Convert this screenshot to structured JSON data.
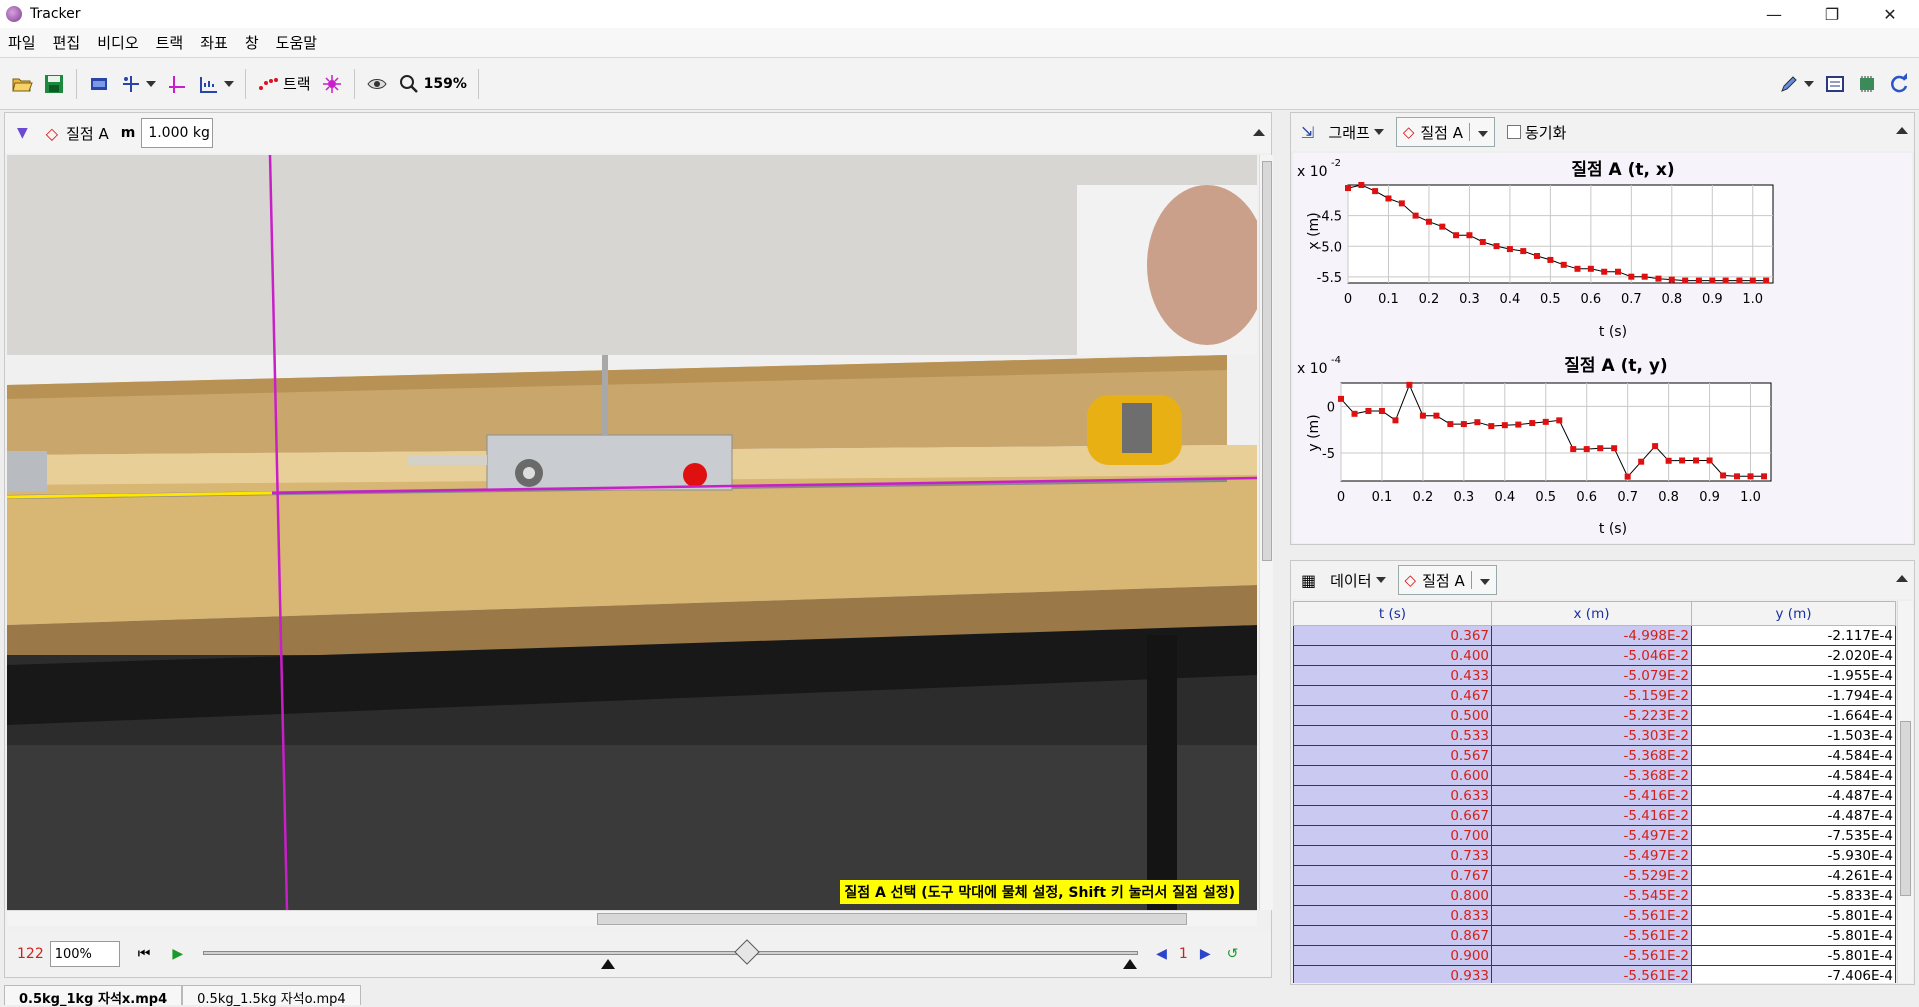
{
  "window": {
    "title": "Tracker"
  },
  "menu": [
    "파일",
    "편집",
    "비디오",
    "트랙",
    "좌표",
    "창",
    "도움말"
  ],
  "toolbar": {
    "track_label": "트랙",
    "zoom": "159%"
  },
  "trackbar": {
    "track_name": "질점 A",
    "mass_label": "m",
    "mass_value": "1.000 kg"
  },
  "video": {
    "status_message": "질점 A 선택 (도구 막대에 물체 설정, Shift 키 눌러서 질점 설정)"
  },
  "player": {
    "frame": "122",
    "rate": "100%",
    "step": "1"
  },
  "graph_panel": {
    "view_label": "그래프",
    "track_label": "질점 A",
    "sync_label": "동기화",
    "charts": [
      {
        "title": "질점 A (t, x)",
        "exp": "x 10",
        "exp_power": "-2",
        "xlabel": "t (s)",
        "ylabel": "x (m)",
        "yticks": [
          "-4.5",
          "-5.0",
          "-5.5"
        ],
        "xticks": [
          "0",
          "0.1",
          "0.2",
          "0.3",
          "0.4",
          "0.5",
          "0.6",
          "0.7",
          "0.8",
          "0.9",
          "1.0"
        ]
      },
      {
        "title": "질점 A (t, y)",
        "exp": "x 10",
        "exp_power": "-4",
        "xlabel": "t (s)",
        "ylabel": "y (m)",
        "yticks": [
          "0",
          "-5"
        ],
        "xticks": [
          "0",
          "0.1",
          "0.2",
          "0.3",
          "0.4",
          "0.5",
          "0.6",
          "0.7",
          "0.8",
          "0.9",
          "1.0"
        ]
      }
    ]
  },
  "chart_data": [
    {
      "type": "scatter",
      "title": "질점 A (t, x)",
      "xlabel": "t (s)",
      "ylabel": "x (m)",
      "xlim": [
        0,
        1.05
      ],
      "ylim": [
        -5.6,
        -4.0
      ],
      "y_scale_note": "x 10^-2",
      "x": [
        0,
        0.033,
        0.067,
        0.1,
        0.133,
        0.167,
        0.2,
        0.233,
        0.267,
        0.3,
        0.333,
        0.367,
        0.4,
        0.433,
        0.467,
        0.5,
        0.533,
        0.567,
        0.6,
        0.633,
        0.667,
        0.7,
        0.733,
        0.767,
        0.8,
        0.833,
        0.867,
        0.9,
        0.933,
        0.967,
        1.0,
        1.033
      ],
      "y": [
        -4.05,
        -4.0,
        -4.1,
        -4.22,
        -4.3,
        -4.5,
        -4.6,
        -4.68,
        -4.82,
        -4.82,
        -4.93,
        -4.998,
        -5.046,
        -5.079,
        -5.159,
        -5.223,
        -5.303,
        -5.368,
        -5.368,
        -5.416,
        -5.416,
        -5.497,
        -5.497,
        -5.529,
        -5.545,
        -5.561,
        -5.561,
        -5.561,
        -5.561,
        -5.561,
        -5.561,
        -5.561
      ]
    },
    {
      "type": "scatter",
      "title": "질점 A (t, y)",
      "xlabel": "t (s)",
      "ylabel": "y (m)",
      "xlim": [
        0,
        1.05
      ],
      "ylim": [
        -8.0,
        2.5
      ],
      "y_scale_note": "x 10^-4",
      "x": [
        0,
        0.033,
        0.067,
        0.1,
        0.133,
        0.167,
        0.2,
        0.233,
        0.267,
        0.3,
        0.333,
        0.367,
        0.4,
        0.433,
        0.467,
        0.5,
        0.533,
        0.567,
        0.6,
        0.633,
        0.667,
        0.7,
        0.733,
        0.767,
        0.8,
        0.833,
        0.867,
        0.9,
        0.933,
        0.967,
        1.0,
        1.033
      ],
      "y": [
        0.8,
        -0.8,
        -0.5,
        -0.5,
        -1.5,
        2.3,
        -1.0,
        -1.0,
        -1.9,
        -1.9,
        -1.7,
        -2.117,
        -2.02,
        -1.955,
        -1.794,
        -1.664,
        -1.503,
        -4.584,
        -4.584,
        -4.487,
        -4.487,
        -7.535,
        -5.93,
        -4.261,
        -5.833,
        -5.801,
        -5.801,
        -5.801,
        -7.406,
        -7.5,
        -7.5,
        -7.5
      ]
    }
  ],
  "data_panel": {
    "view_label": "데이터",
    "track_label": "질점 A",
    "columns": [
      "t (s)",
      "x (m)",
      "y (m)"
    ],
    "rows": [
      [
        "0.367",
        "-4.998E-2",
        "-2.117E-4"
      ],
      [
        "0.400",
        "-5.046E-2",
        "-2.020E-4"
      ],
      [
        "0.433",
        "-5.079E-2",
        "-1.955E-4"
      ],
      [
        "0.467",
        "-5.159E-2",
        "-1.794E-4"
      ],
      [
        "0.500",
        "-5.223E-2",
        "-1.664E-4"
      ],
      [
        "0.533",
        "-5.303E-2",
        "-1.503E-4"
      ],
      [
        "0.567",
        "-5.368E-2",
        "-4.584E-4"
      ],
      [
        "0.600",
        "-5.368E-2",
        "-4.584E-4"
      ],
      [
        "0.633",
        "-5.416E-2",
        "-4.487E-4"
      ],
      [
        "0.667",
        "-5.416E-2",
        "-4.487E-4"
      ],
      [
        "0.700",
        "-5.497E-2",
        "-7.535E-4"
      ],
      [
        "0.733",
        "-5.497E-2",
        "-5.930E-4"
      ],
      [
        "0.767",
        "-5.529E-2",
        "-4.261E-4"
      ],
      [
        "0.800",
        "-5.545E-2",
        "-5.833E-4"
      ],
      [
        "0.833",
        "-5.561E-2",
        "-5.801E-4"
      ],
      [
        "0.867",
        "-5.561E-2",
        "-5.801E-4"
      ],
      [
        "0.900",
        "-5.561E-2",
        "-5.801E-4"
      ],
      [
        "0.933",
        "-5.561E-2",
        "-7.406E-4"
      ]
    ]
  },
  "file_tabs": [
    "0.5kg_1kg 자석x.mp4",
    "0.5kg_1.5kg 자석o.mp4"
  ],
  "colors": {
    "accent_magenta": "#c81fc8",
    "point_red": "#e01010",
    "table_select": "#c9c9f2"
  }
}
